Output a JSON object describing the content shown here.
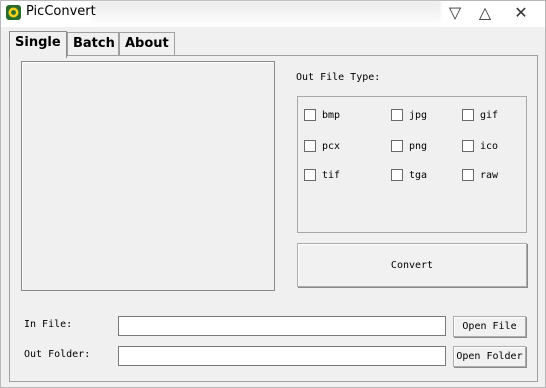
{
  "window": {
    "title": "PicConvert",
    "app_icon": "picconvert-app-icon",
    "controls": {
      "minimize": "▽",
      "maximize": "△",
      "close": "✕"
    }
  },
  "tabs": [
    {
      "label": "Single",
      "active": true
    },
    {
      "label": "Batch",
      "active": false
    },
    {
      "label": "About",
      "active": false
    }
  ],
  "single": {
    "out_file_type_label": "Out File Type:",
    "formats": [
      [
        "bmp",
        "jpg",
        "gif"
      ],
      [
        "pcx",
        "png",
        "ico"
      ],
      [
        "tif",
        "tga",
        "raw"
      ]
    ],
    "convert_label": "Convert",
    "in_file_label": "In File:",
    "in_file_value": "",
    "out_folder_label": "Out Folder:",
    "out_folder_value": "",
    "open_file_label": "Open File",
    "open_folder_label": "Open Folder"
  }
}
